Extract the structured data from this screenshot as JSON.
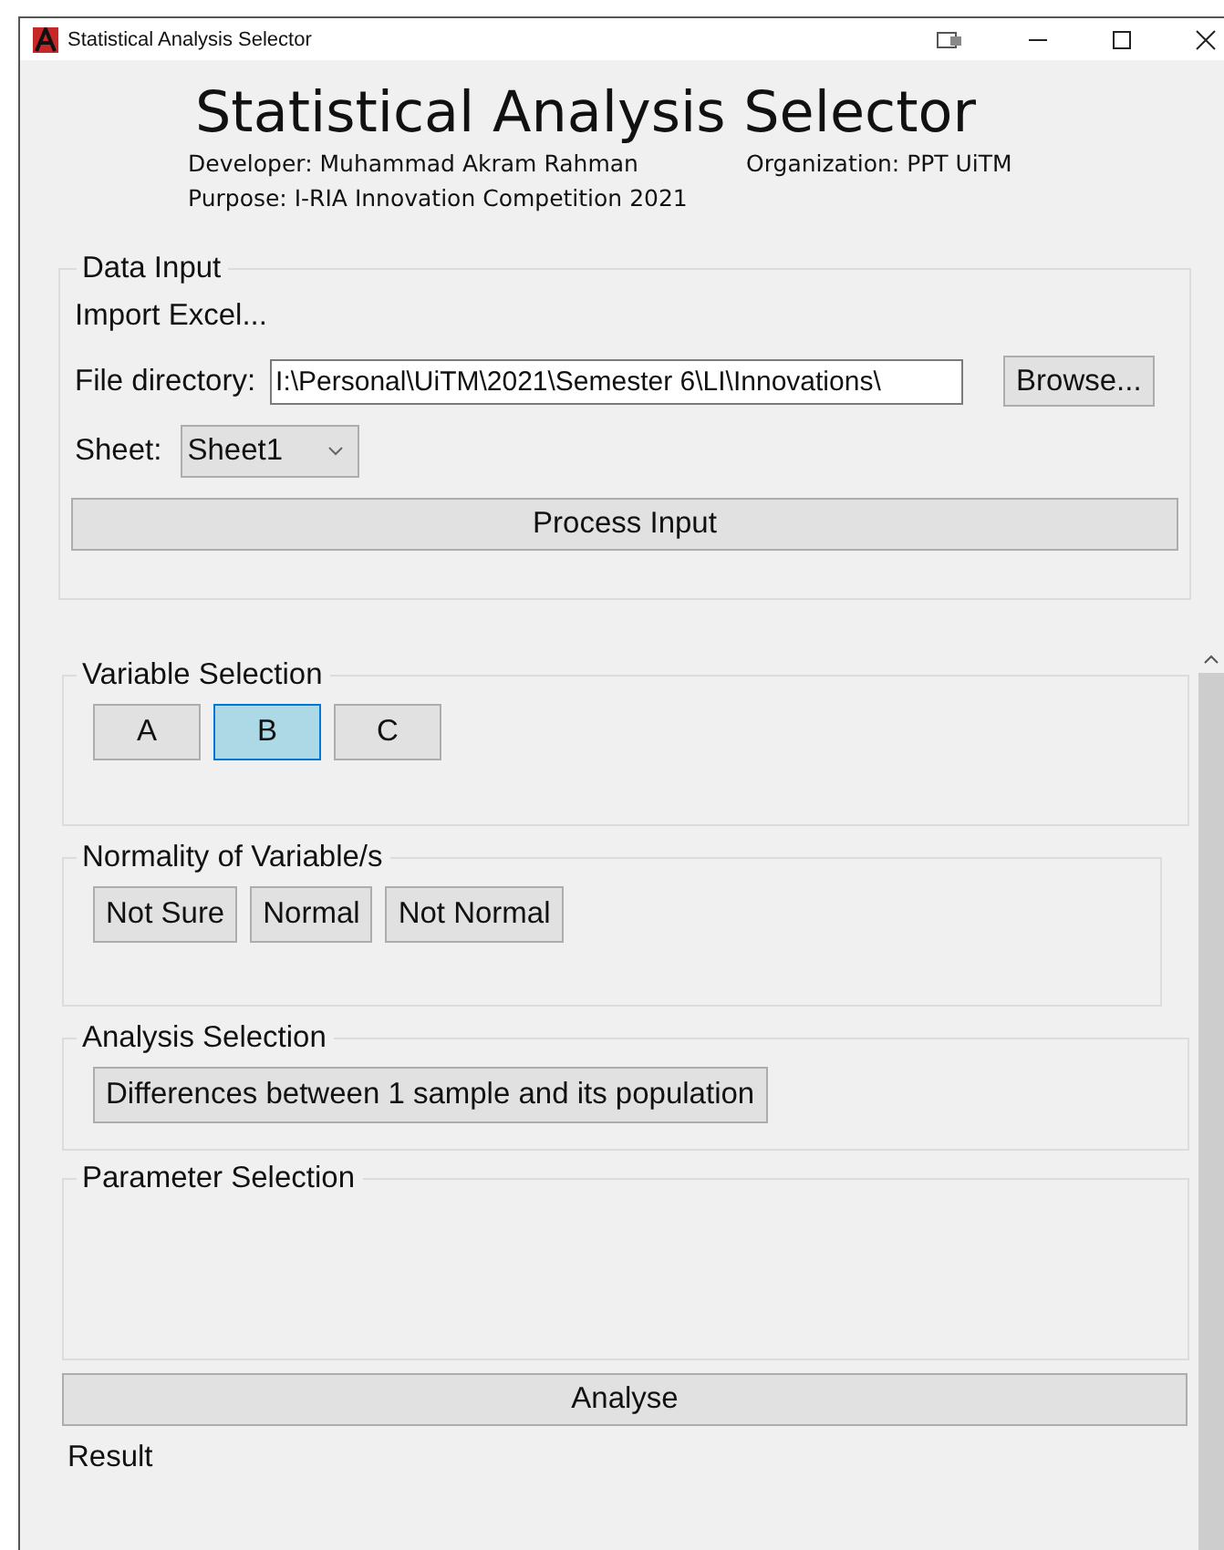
{
  "window": {
    "title": "Statistical Analysis Selector"
  },
  "header": {
    "title": "Statistical Analysis Selector",
    "developer": "Developer: Muhammad Akram Rahman",
    "organization": "Organization: PPT UiTM",
    "purpose": "Purpose: I-RIA Innovation Competition 2021"
  },
  "data_input": {
    "legend": "Data Input",
    "import_label": "Import Excel...",
    "file_label": "File directory:",
    "file_value": "I:\\Personal\\UiTM\\2021\\Semester 6\\LI\\Innovations\\",
    "browse": "Browse...",
    "sheet_label": "Sheet:",
    "sheet_value": "Sheet1",
    "process": "Process Input"
  },
  "variable_selection": {
    "legend": "Variable Selection",
    "options": [
      {
        "label": "A",
        "selected": false
      },
      {
        "label": "B",
        "selected": true
      },
      {
        "label": "C",
        "selected": false
      }
    ]
  },
  "normality": {
    "legend": "Normality of Variable/s",
    "options": [
      {
        "label": "Not Sure",
        "selected": false
      },
      {
        "label": "Normal",
        "selected": false
      },
      {
        "label": "Not Normal",
        "selected": false
      }
    ]
  },
  "analysis": {
    "legend": "Analysis Selection",
    "options": [
      {
        "label": "Differences between 1 sample and its population",
        "selected": false
      }
    ]
  },
  "parameter": {
    "legend": "Parameter Selection"
  },
  "analyse_button": "Analyse",
  "result_label": "Result"
}
